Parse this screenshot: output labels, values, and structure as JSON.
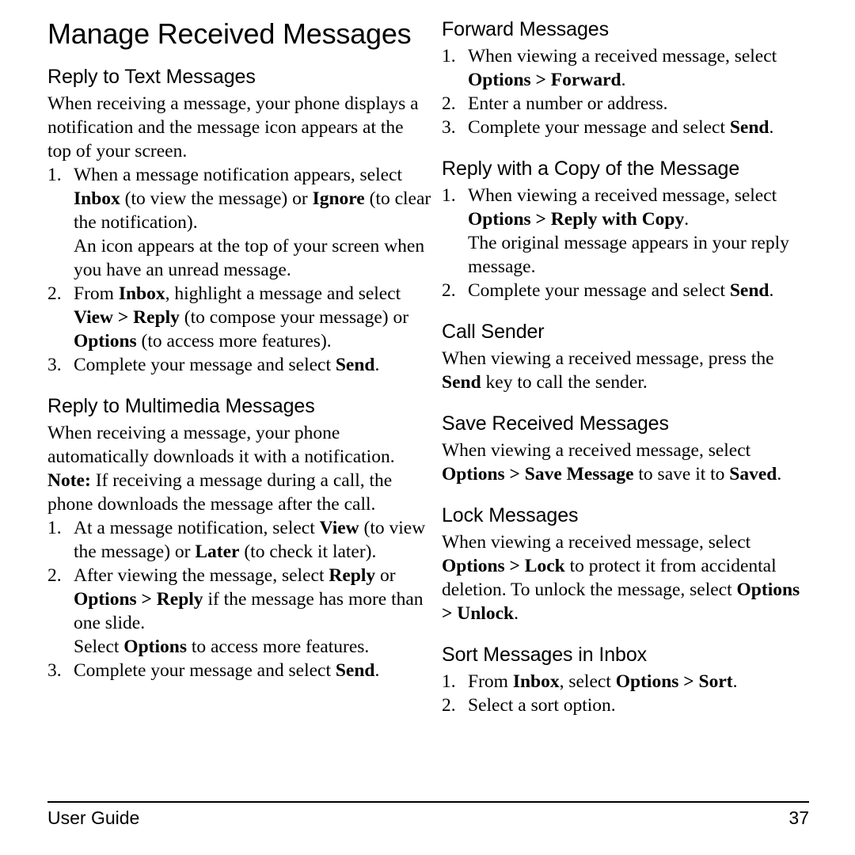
{
  "document": {
    "title": "Manage Received Messages"
  },
  "left_column": {
    "sections": [
      {
        "heading": "Reply to Text Messages",
        "intro": "When receiving a message, your phone displays a notification and the message icon appears at the top of your screen.",
        "steps": [
          {
            "num": "1.",
            "text_a": "When a message notification appears, select ",
            "bold_a": "Inbox",
            "text_b": " (to view the message) or ",
            "bold_b": "Ignore",
            "text_c": " (to clear the notification).",
            "substep": "An icon appears at the top of your screen when you have an unread message."
          },
          {
            "num": "2.",
            "text_a": "From ",
            "bold_a": "Inbox",
            "text_b": ", highlight a message and select ",
            "bold_b": "View > Reply",
            "text_c": " (to compose your message) or ",
            "bold_c": "Options",
            "text_d": " (to access more features)."
          },
          {
            "num": "3.",
            "text_a": "Complete your message and select ",
            "bold_a": "Send",
            "text_b": "."
          }
        ]
      },
      {
        "heading": "Reply to Multimedia Messages",
        "intro": "When receiving a message, your phone automatically downloads it with a notification.",
        "note_label": "Note:",
        "note_text": " If receiving a message during a call, the phone downloads the message after the call.",
        "steps": [
          {
            "num": "1.",
            "text_a": "At a message notification, select ",
            "bold_a": "View",
            "text_b": " (to view the message) or ",
            "bold_b": "Later",
            "text_c": " (to check it later)."
          },
          {
            "num": "2.",
            "text_a": "After viewing the message, select ",
            "bold_a": "Reply",
            "text_b": " or ",
            "bold_b": "Options > Reply",
            "text_c": " if the message has more than one slide.",
            "substep_a": "Select ",
            "substep_bold": "Options",
            "substep_b": " to access more features."
          },
          {
            "num": "3.",
            "text_a": "Complete your message and select ",
            "bold_a": "Send",
            "text_b": "."
          }
        ]
      }
    ]
  },
  "right_column": {
    "sections": [
      {
        "heading": "Forward Messages",
        "steps": [
          {
            "num": "1.",
            "text_a": "When viewing a received message, select ",
            "bold_a": "Options > Forward",
            "text_b": "."
          },
          {
            "num": "2.",
            "text_a": "Enter a number or address."
          },
          {
            "num": "3.",
            "text_a": "Complete your message and select ",
            "bold_a": "Send",
            "text_b": "."
          }
        ]
      },
      {
        "heading": "Reply with a Copy of the Message",
        "steps": [
          {
            "num": "1.",
            "text_a": "When viewing a received message, select ",
            "bold_a": "Options > Reply with Copy",
            "text_b": ".",
            "substep": "The original message appears in your reply message."
          },
          {
            "num": "2.",
            "text_a": "Complete your message and select ",
            "bold_a": "Send",
            "text_b": "."
          }
        ]
      },
      {
        "heading": "Call Sender",
        "para_a": "When viewing a received message, press the ",
        "para_bold": "Send",
        "para_b": " key to call the sender."
      },
      {
        "heading": "Save Received Messages",
        "para_a": "When viewing a received message, select ",
        "para_bold_a": "Options > Save Message",
        "para_b": " to save it to ",
        "para_bold_b": "Saved",
        "para_c": "."
      },
      {
        "heading": "Lock Messages",
        "para_a": "When viewing a received message, select ",
        "para_bold_a": "Options > Lock",
        "para_b": " to protect it from accidental deletion. To unlock the message, select ",
        "para_bold_b": "Options > Unlock",
        "para_c": "."
      },
      {
        "heading": "Sort Messages in Inbox",
        "steps": [
          {
            "num": "1.",
            "text_a": "From ",
            "bold_a": "Inbox",
            "text_b": ", select ",
            "bold_b": "Options > Sort",
            "text_c": "."
          },
          {
            "num": "2.",
            "text_a": "Select a sort option."
          }
        ]
      }
    ]
  },
  "footer": {
    "left": "User Guide",
    "page_number": "37"
  }
}
